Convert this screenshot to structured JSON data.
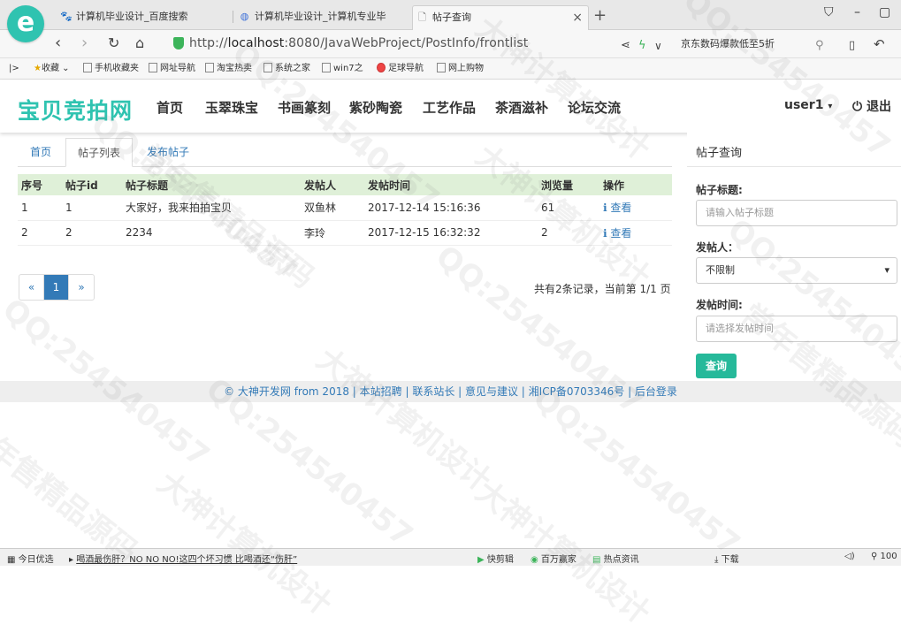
{
  "browser": {
    "tabs": [
      {
        "label": "计算机毕业设计_百度搜索",
        "icon": "paw-icon"
      },
      {
        "label": "计算机毕业设计_计算机专业毕",
        "icon": "page-icon"
      },
      {
        "label": "帖子查询",
        "icon": "document-icon"
      }
    ],
    "url_prefix": "http://",
    "url_host": "localhost",
    "url_rest": ":8080/JavaWebProject/PostInfo/frontlist",
    "search_text": "京东数码爆款低至5折",
    "bookmarks": [
      "收藏",
      "手机收藏夹",
      "网址导航",
      "淘宝热卖",
      "系统之家",
      "win7之",
      "足球导航",
      "网上购物"
    ]
  },
  "site": {
    "brand": "宝贝竞拍网",
    "menu": [
      "首页",
      "玉翠珠宝",
      "书画篆刻",
      "紫砂陶瓷",
      "工艺作品",
      "茶酒滋补",
      "论坛交流"
    ],
    "user": "user1",
    "logout": "退出"
  },
  "pills": [
    "首页",
    "帖子列表",
    "发布帖子"
  ],
  "table": {
    "headers": [
      "序号",
      "帖子id",
      "帖子标题",
      "发帖人",
      "发帖时间",
      "浏览量",
      "操作"
    ],
    "rows": [
      [
        "1",
        "1",
        "大家好，我来拍拍宝贝",
        "双鱼林",
        "2017-12-14 15:16:36",
        "61",
        "查看"
      ],
      [
        "2",
        "2",
        "2234",
        "李玲",
        "2017-12-15 16:32:32",
        "2",
        "查看"
      ]
    ]
  },
  "pager": {
    "prev": "«",
    "current": "1",
    "next": "»"
  },
  "record_info": "共有2条记录，当前第 1/1 页",
  "query": {
    "title": "帖子查询",
    "title_label": "帖子标题:",
    "title_placeholder": "请输入帖子标题",
    "user_label": "发帖人：",
    "user_value": "不限制",
    "time_label": "发帖时间:",
    "time_placeholder": "请选择发帖时间",
    "button": "查询"
  },
  "footer": "© 大神开发网 from 2018 | 本站招聘 | 联系站长 | 意见与建议 | 湘ICP备0703346号 | 后台登录",
  "statusbar": {
    "left": "今日优选",
    "news": "喝酒最伤肝？NO NO NO!这四个坏习惯 比喝酒还“伤肝”",
    "items": [
      "快剪辑",
      "百万赢家",
      "热点资讯",
      "下载"
    ],
    "zoom": "100"
  },
  "watermarks": [
    "大神计算机设计",
    "QQ:254540457",
    "常年售精品源码"
  ]
}
